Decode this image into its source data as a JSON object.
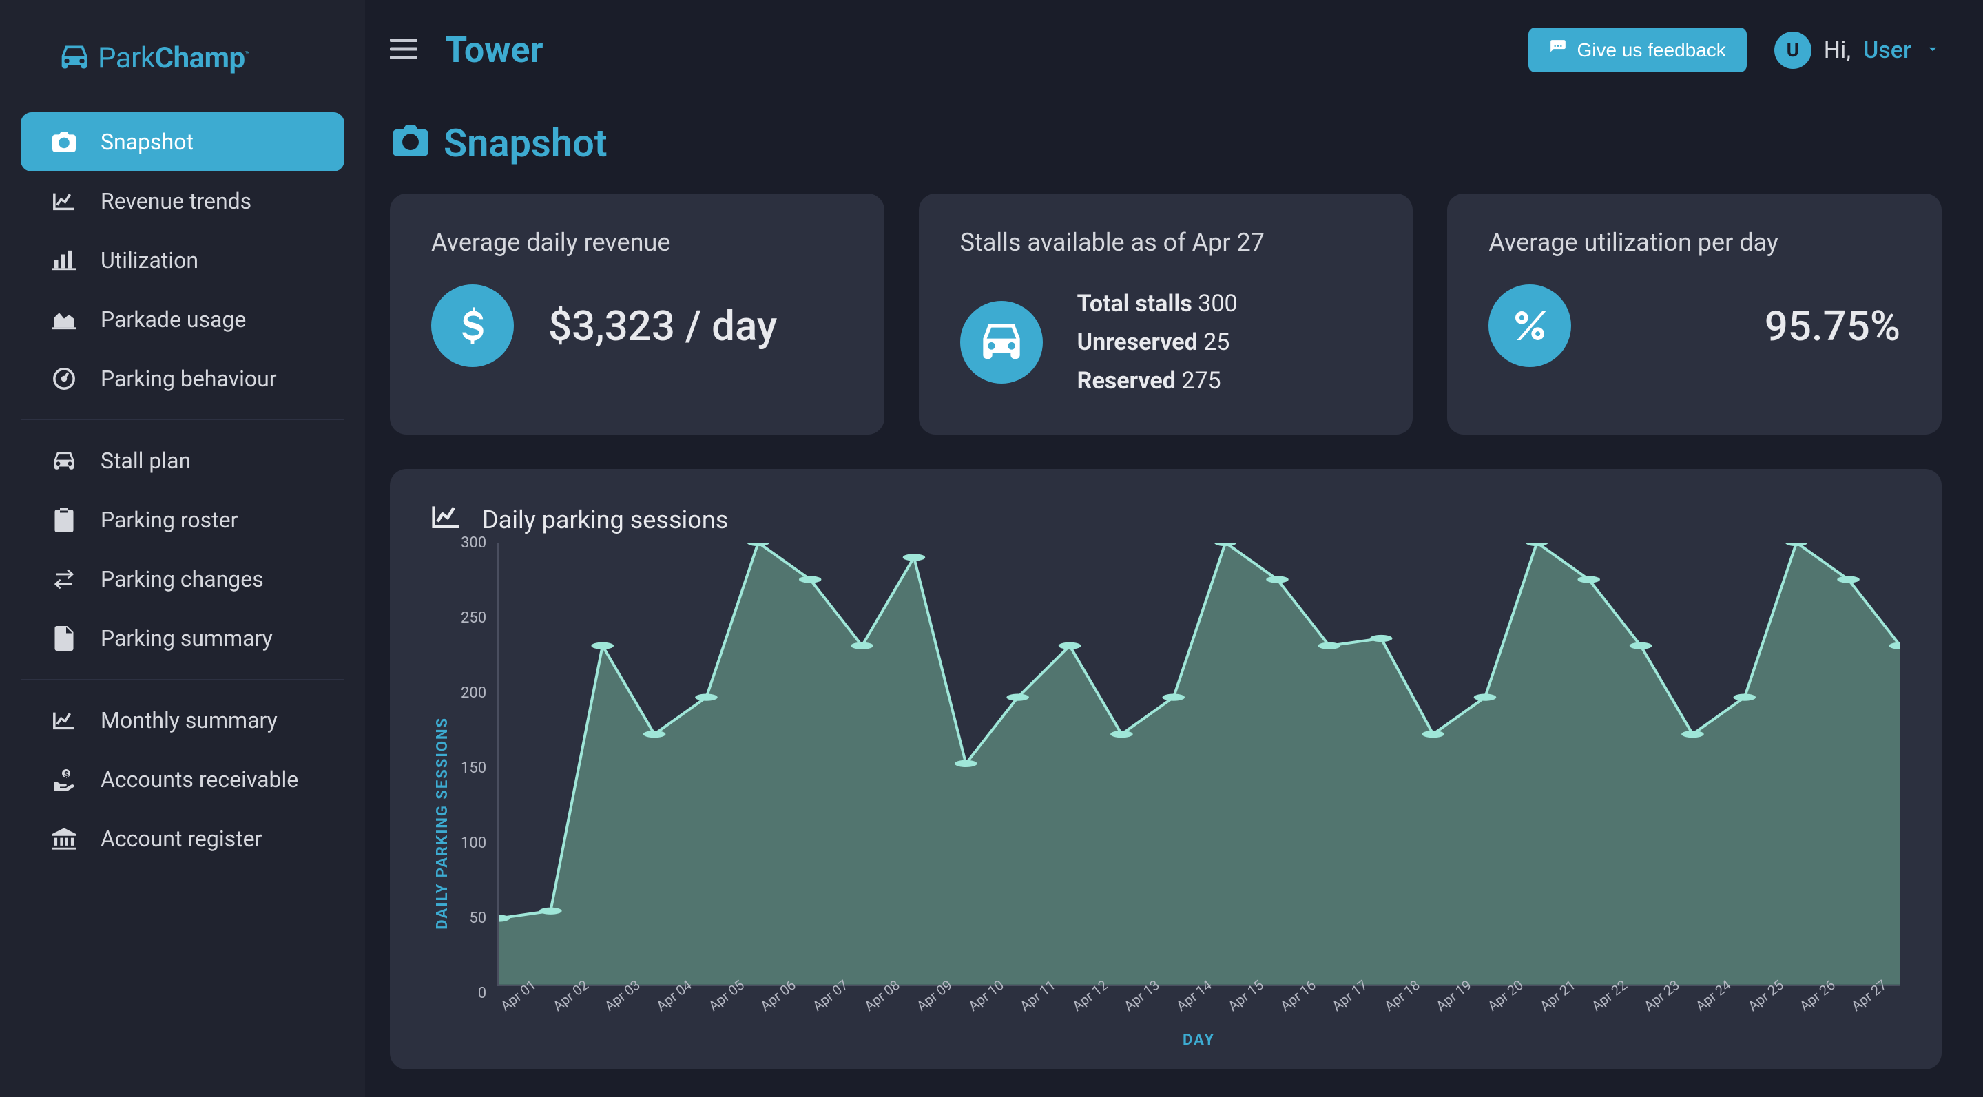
{
  "brand": {
    "park": "Park",
    "champ": "Champ"
  },
  "sidebar": {
    "items": [
      {
        "label": "Snapshot",
        "icon": "camera",
        "active": true
      },
      {
        "label": "Revenue trends",
        "icon": "line-chart"
      },
      {
        "label": "Utilization",
        "icon": "bar-chart"
      },
      {
        "label": "Parkade usage",
        "icon": "area-chart"
      },
      {
        "label": "Parking behaviour",
        "icon": "gauge"
      }
    ],
    "section2": [
      {
        "label": "Stall plan",
        "icon": "car"
      },
      {
        "label": "Parking roster",
        "icon": "clipboard"
      },
      {
        "label": "Parking changes",
        "icon": "swap"
      },
      {
        "label": "Parking summary",
        "icon": "file"
      }
    ],
    "section3": [
      {
        "label": "Monthly summary",
        "icon": "line-chart"
      },
      {
        "label": "Accounts receivable",
        "icon": "hand-dollar"
      },
      {
        "label": "Account register",
        "icon": "bank"
      }
    ]
  },
  "topbar": {
    "location": "Tower",
    "feedback_label": "Give us feedback",
    "greeting": "Hi,",
    "user_initial": "U",
    "user_name": "User"
  },
  "page": {
    "title": "Snapshot"
  },
  "cards": {
    "revenue": {
      "title": "Average daily revenue",
      "value": "$3,323 / day"
    },
    "stalls": {
      "title": "Stalls available as of Apr 27",
      "total_label": "Total stalls",
      "total_value": "300",
      "unreserved_label": "Unreserved",
      "unreserved_value": "25",
      "reserved_label": "Reserved",
      "reserved_value": "275"
    },
    "utilization": {
      "title": "Average utilization per day",
      "value": "95.75%"
    }
  },
  "chart_data": {
    "type": "line",
    "title": "Daily parking sessions",
    "xlabel": "DAY",
    "ylabel": "DAILY PARKING SESSIONS",
    "ylim": [
      0,
      300
    ],
    "yticks": [
      0,
      50,
      100,
      150,
      200,
      250,
      300
    ],
    "categories": [
      "Apr 01",
      "Apr 02",
      "Apr 03",
      "Apr 04",
      "Apr 05",
      "Apr 06",
      "Apr 07",
      "Apr 08",
      "Apr 09",
      "Apr 10",
      "Apr 11",
      "Apr 12",
      "Apr 13",
      "Apr 14",
      "Apr 15",
      "Apr 16",
      "Apr 17",
      "Apr 18",
      "Apr 19",
      "Apr 20",
      "Apr 21",
      "Apr 22",
      "Apr 23",
      "Apr 24",
      "Apr 25",
      "Apr 26",
      "Apr 27"
    ],
    "values": [
      45,
      50,
      230,
      170,
      195,
      300,
      275,
      230,
      290,
      150,
      195,
      230,
      170,
      195,
      300,
      275,
      230,
      235,
      170,
      195,
      300,
      275,
      230,
      170,
      195,
      300,
      275,
      230
    ]
  }
}
